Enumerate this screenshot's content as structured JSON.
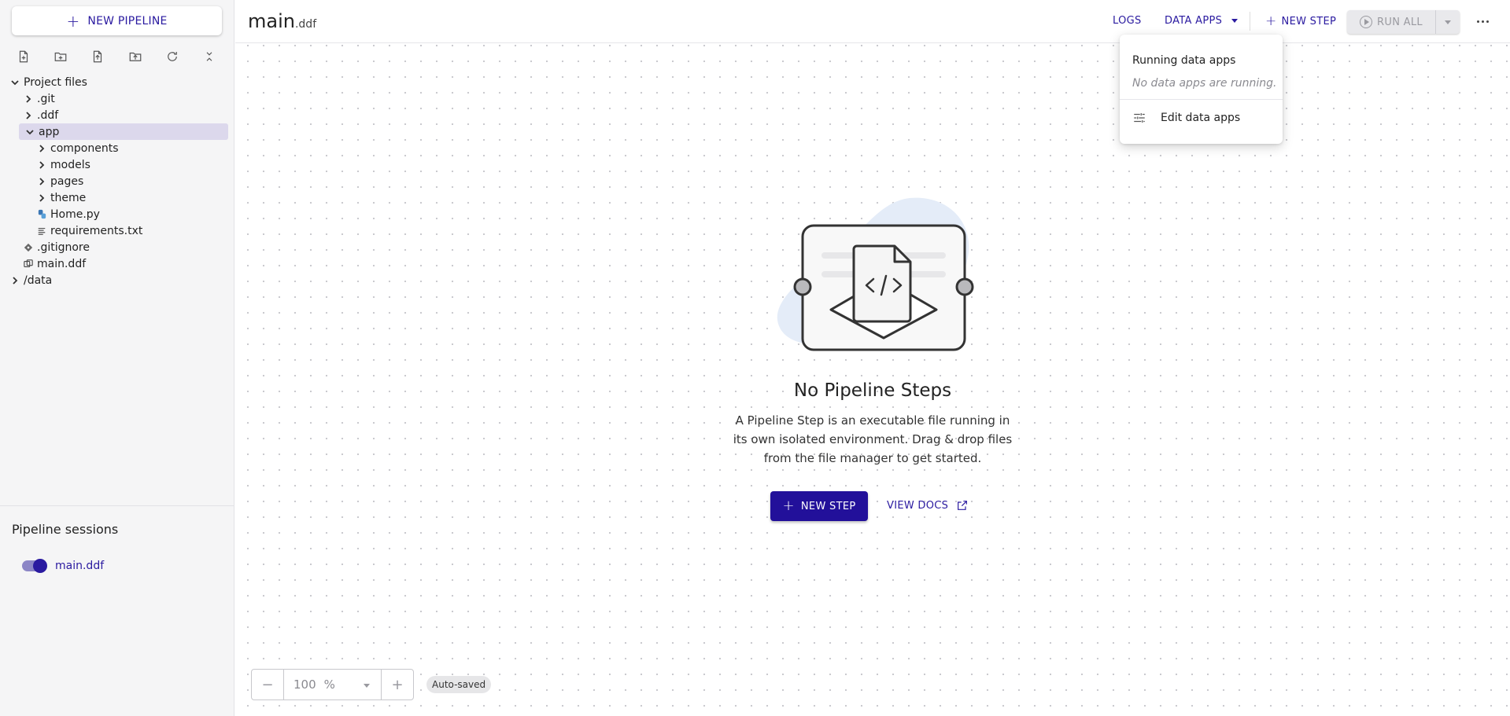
{
  "sidebar": {
    "new_pipeline_label": "NEW PIPELINE",
    "tree": [
      {
        "label": "Project files",
        "level": 0,
        "type": "root-open"
      },
      {
        "label": ".git",
        "level": 1,
        "type": "folder"
      },
      {
        "label": ".ddf",
        "level": 1,
        "type": "folder"
      },
      {
        "label": "app",
        "level": 1,
        "type": "folder-open",
        "selected": true
      },
      {
        "label": "components",
        "level": 2,
        "type": "folder"
      },
      {
        "label": "models",
        "level": 2,
        "type": "folder"
      },
      {
        "label": "pages",
        "level": 2,
        "type": "folder"
      },
      {
        "label": "theme",
        "level": 2,
        "type": "folder"
      },
      {
        "label": "Home.py",
        "level": 2,
        "type": "python"
      },
      {
        "label": "requirements.txt",
        "level": 2,
        "type": "text"
      },
      {
        "label": ".gitignore",
        "level": 1,
        "type": "git"
      },
      {
        "label": "main.ddf",
        "level": 1,
        "type": "pipeline"
      },
      {
        "label": "/data",
        "level": 0,
        "type": "folder"
      }
    ],
    "sessions_title": "Pipeline sessions",
    "session_item": "main.ddf"
  },
  "header": {
    "title": "main",
    "title_ext": ".ddf",
    "logs_label": "LOGS",
    "data_apps_label": "DATA APPS",
    "new_step_label": "NEW STEP",
    "run_all_label": "RUN ALL"
  },
  "data_apps_menu": {
    "heading": "Running data apps",
    "empty_text": "No data apps are running.",
    "edit_label": "Edit data apps"
  },
  "empty_state": {
    "title": "No Pipeline Steps",
    "description": "A Pipeline Step is an executable file running in its own isolated environment. Drag & drop files from the file manager to get started.",
    "new_step_label": "NEW STEP",
    "docs_label": "VIEW DOCS"
  },
  "zoom": {
    "minus": "−",
    "value": "100",
    "unit": "%",
    "plus": "+"
  },
  "status": {
    "autosaved": "Auto-saved"
  },
  "colors": {
    "accent": "#22109a",
    "selected_row": "#dcd8ec"
  }
}
